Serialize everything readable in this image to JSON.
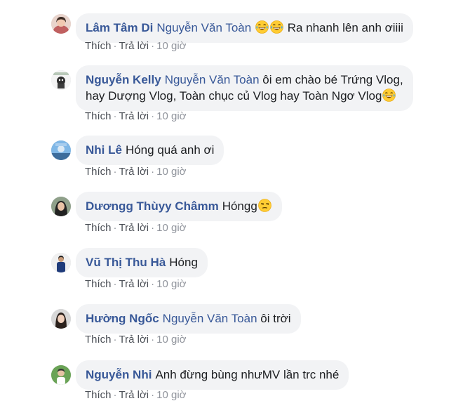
{
  "comments": [
    {
      "author": "Lâm Tâm Di",
      "mention": "Nguyễn Văn Toàn",
      "text_before": "",
      "text_after": "Ra nhanh lên anh ơiiii",
      "emojis": [
        "face-with-tears-of-joy",
        "face-with-tears-of-joy"
      ],
      "like": "Thích",
      "reply": "Trả lời",
      "time": "10 giờ"
    },
    {
      "author": "Nguyễn Kelly",
      "mention": "Nguyễn Văn Toàn",
      "text_line1": "ôi em chào bé Trứng Vlog,",
      "text_line2": "hay Dượng Vlog, Toàn chục củ Vlog hay Toàn Ngơ Vlog",
      "emojis": [
        "face-with-tears-of-joy"
      ],
      "like": "Thích",
      "reply": "Trả lời",
      "time": "10 giờ"
    },
    {
      "author": "Nhi Lê",
      "text": "Hóng quá anh ơi",
      "like": "Thích",
      "reply": "Trả lời",
      "time": "10 giờ"
    },
    {
      "author": "Dươngg Thùyy Châmm",
      "text": "Hóngg",
      "emojis": [
        "unamused-face"
      ],
      "like": "Thích",
      "reply": "Trả lời",
      "time": "10 giờ"
    },
    {
      "author": "Vũ Thị Thu Hà",
      "text": "Hóng",
      "like": "Thích",
      "reply": "Trả lời",
      "time": "10 giờ"
    },
    {
      "author": "Hường Ngốc",
      "mention": "Nguyễn Văn Toàn",
      "text": "ôi trời",
      "like": "Thích",
      "reply": "Trả lời",
      "time": "10 giờ"
    },
    {
      "author": "Nguyễn Nhi",
      "text": "Anh đừng bùng nhưMV lần trc nhé",
      "like": "Thích",
      "reply": "Trả lời",
      "time": "10 giờ"
    }
  ],
  "colors": {
    "author": "#385898",
    "bubble": "#f2f3f5",
    "meta": "#90949c"
  }
}
